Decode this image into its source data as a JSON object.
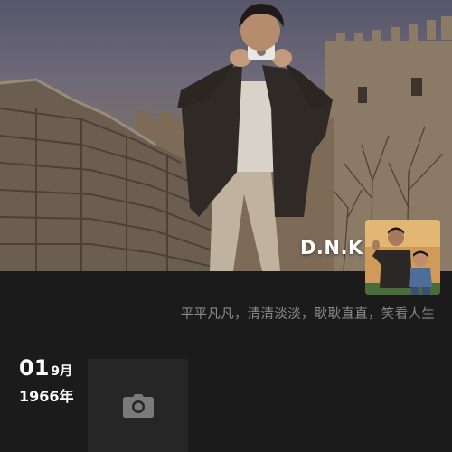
{
  "profile": {
    "username": "D.N.K",
    "signature": "平平凡凡，清清淡淡，耿耿直直，笑看人生"
  },
  "timeline": {
    "entries": [
      {
        "day": "01",
        "month": "9月",
        "year": "1966年"
      }
    ]
  },
  "icons": {
    "camera": "camera-icon"
  },
  "colors": {
    "background": "#1b1b1b",
    "signature_text": "#8a8a8a",
    "photo_tile": "#262626"
  }
}
